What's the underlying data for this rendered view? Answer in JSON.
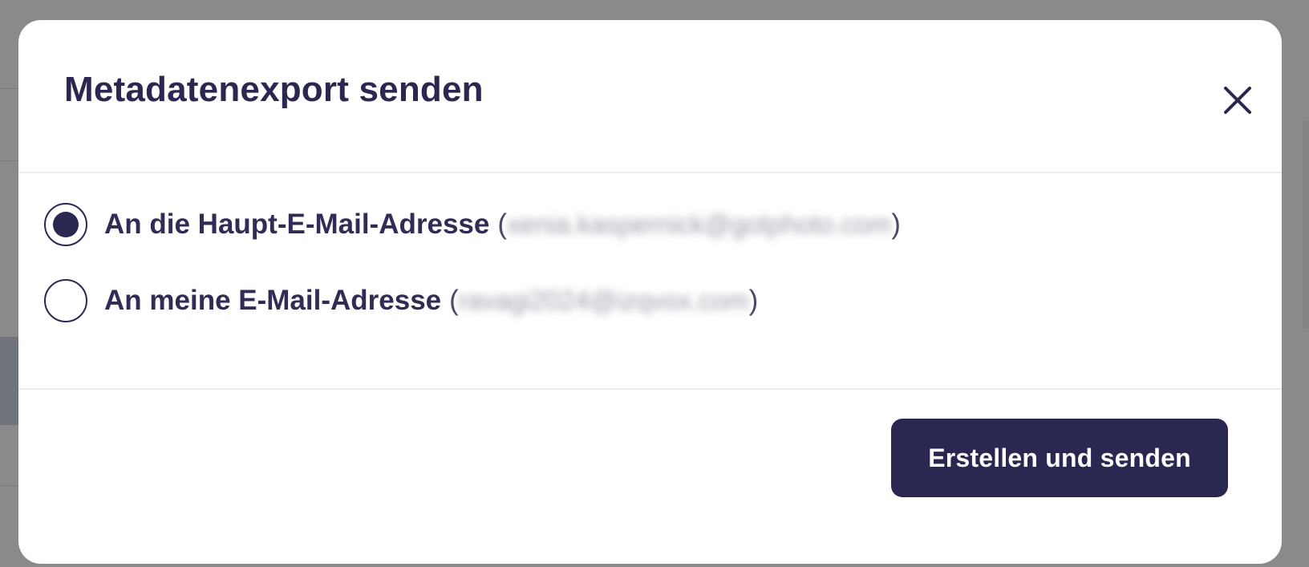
{
  "dialog": {
    "title": "Metadatenexport senden",
    "close_icon": "close-icon",
    "options": [
      {
        "label": "An die Haupt-E-Mail-Adresse",
        "email": "xenia.kaspernick@gotphoto.com",
        "selected": true
      },
      {
        "label": "An meine E-Mail-Adresse",
        "email": "ravagi2024@izqvox.com",
        "selected": false
      }
    ],
    "submit_label": "Erstellen und senden",
    "paren_open": "(",
    "paren_close": ")"
  },
  "colors": {
    "primary": "#2a2850",
    "overlay": "#8a8a8a",
    "divider": "#ececf0"
  }
}
